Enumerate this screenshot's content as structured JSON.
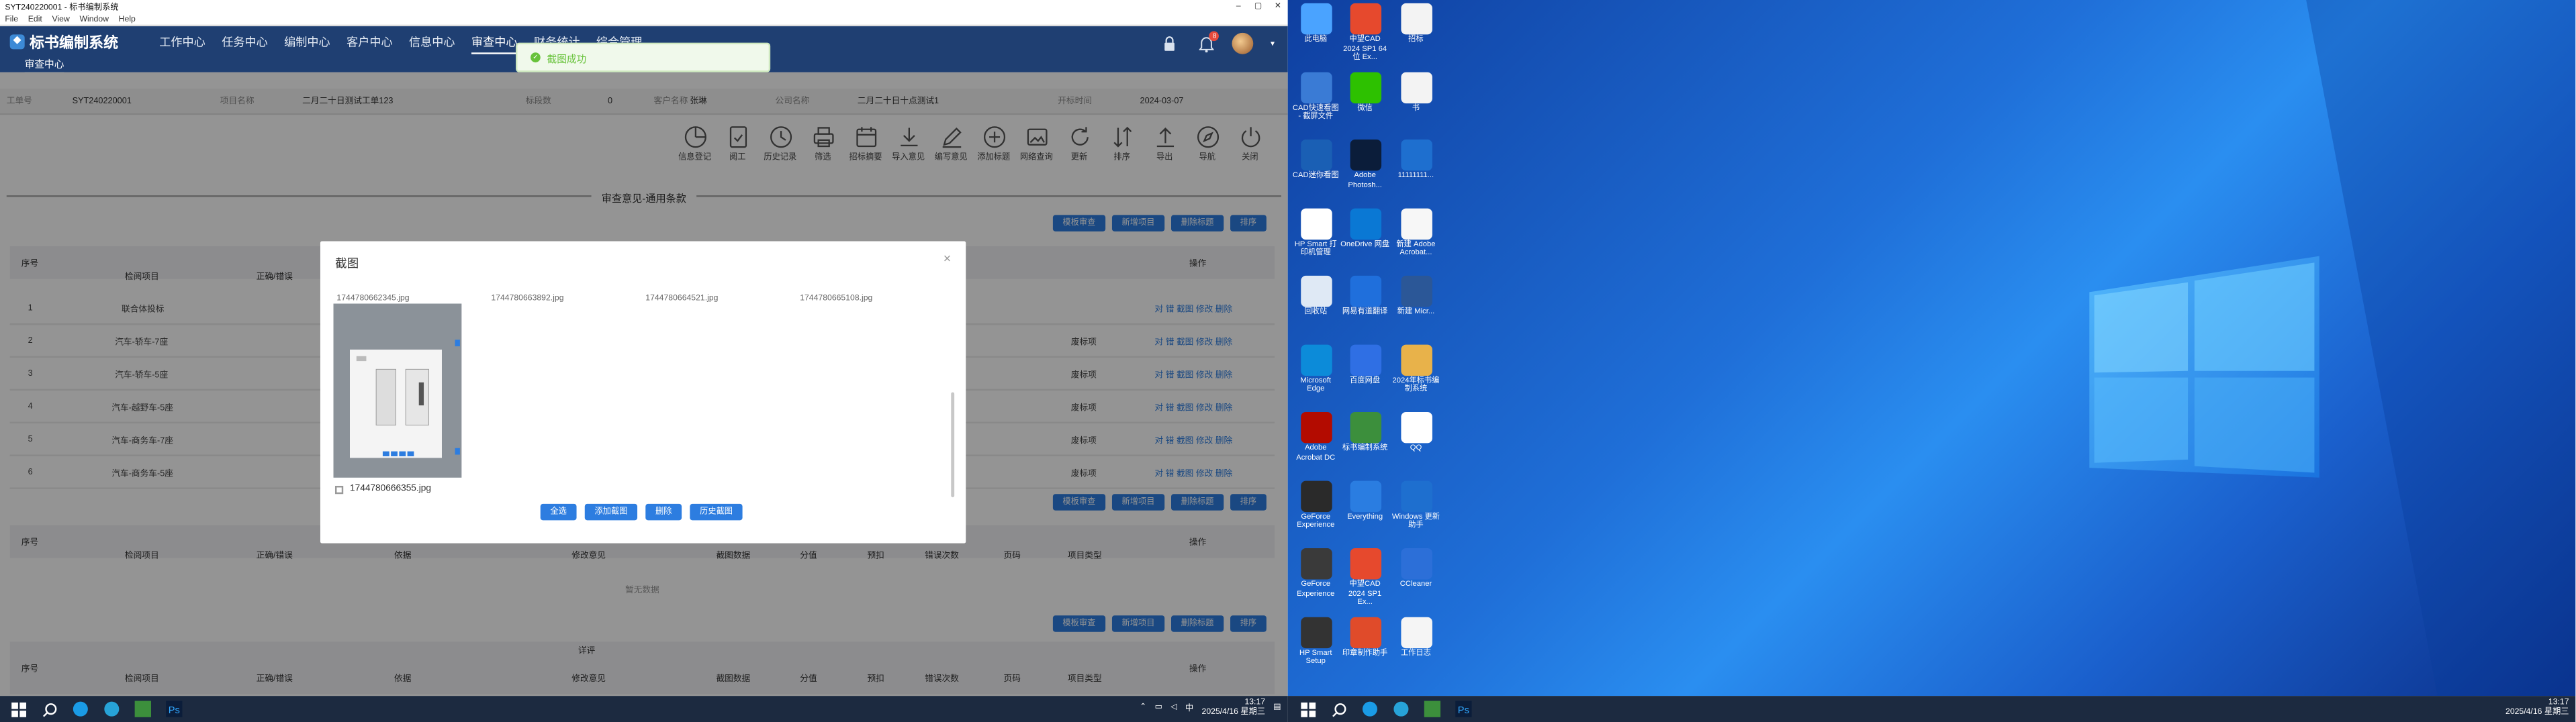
{
  "window": {
    "title": "SYT240220001 - 标书编制系统",
    "menu": [
      "File",
      "Edit",
      "View",
      "Window",
      "Help"
    ]
  },
  "appbar": {
    "logo": "标书编制系统",
    "nav": [
      "工作中心",
      "任务中心",
      "编制中心",
      "客户中心",
      "信息中心",
      "审查中心",
      "财务统计",
      "综合管理"
    ],
    "active_nav": "审查中心",
    "subnav": "审查中心",
    "badge_count": "8"
  },
  "toast": {
    "text": "截图成功"
  },
  "info": [
    {
      "label": "工单号",
      "value": "SYT240220001"
    },
    {
      "label": "项目名称",
      "value": "二月二十日测试工单123"
    },
    {
      "label": "标段数",
      "value": "0"
    },
    {
      "label": "客户名称",
      "value": "张琳"
    },
    {
      "label": "公司名称",
      "value": "二月二十日十点测试1"
    },
    {
      "label": "开标时间",
      "value": "2024-03-07"
    }
  ],
  "toolbar": [
    "信息登记",
    "阅工",
    "历史记录",
    "筛选",
    "招标摘要",
    "导入意见",
    "编写意见",
    "添加标题",
    "网络查询",
    "更新",
    "排序",
    "导出",
    "导航",
    "关闭"
  ],
  "section_title": "审查意见-通用条款",
  "action_buttons": [
    "模板审查",
    "新增项目",
    "删除标题",
    "排序"
  ],
  "table": {
    "headers": [
      "序号",
      "检阅项目",
      "正确/错误",
      "依据",
      "修改意见",
      "截图数据",
      "分值",
      "预扣",
      "错误次数",
      "页码",
      "项目类型",
      "操作"
    ],
    "rows": [
      {
        "no": "1",
        "item": "联合体投标",
        "type": "",
        "ops": "对  错  截图  修改  删除"
      },
      {
        "no": "2",
        "item": "汽车-轿车-7座",
        "type": "废标项",
        "ops": "对  错  截图  修改  删除"
      },
      {
        "no": "3",
        "item": "汽车-轿车-5座",
        "type": "废标项",
        "ops": "对  错  截图  修改  删除"
      },
      {
        "no": "4",
        "item": "汽车-越野车-5座",
        "type": "废标项",
        "ops": "对  错  截图  修改  删除"
      },
      {
        "no": "5",
        "item": "汽车-商务车-7座",
        "type": "废标项",
        "ops": "对  错  截图  修改  删除"
      },
      {
        "no": "6",
        "item": "汽车-商务车-5座",
        "type": "废标项",
        "ops": "对  错  截图  修改  删除"
      }
    ],
    "empty_text": "暂无数据",
    "section3_label": "详评"
  },
  "modal": {
    "title": "截图",
    "prev_names": [
      "1744780662345.jpg",
      "1744780663892.jpg",
      "1744780664521.jpg",
      "1744780665108.jpg"
    ],
    "file_name": "1744780666355.jpg",
    "buttons": [
      "全选",
      "添加截图",
      "删除",
      "历史截图"
    ]
  },
  "desktop_icons": [
    {
      "label": "此电脑",
      "color": "#4aa3ff"
    },
    {
      "label": "中望CAD 2024 SP1 64位 Ex...",
      "color": "#e6492d"
    },
    {
      "label": "招标",
      "color": "#f3f3f3"
    },
    {
      "label": "CAD快速看图 - 截屏文件",
      "color": "#3a7bd5"
    },
    {
      "label": "微信",
      "color": "#2dc100"
    },
    {
      "label": "书",
      "color": "#f3f3f3"
    },
    {
      "label": "CAD迷你看图",
      "color": "#1a5fb4"
    },
    {
      "label": "Adobe Photosh...",
      "color": "#0b1d3a"
    },
    {
      "label": "11111111...",
      "color": "#1e6fcf"
    },
    {
      "label": "HP Smart 打印机管理",
      "color": "#ffffff"
    },
    {
      "label": "OneDrive 网盘",
      "color": "#0a78d4"
    },
    {
      "label": "新建 Adobe Acrobat...",
      "color": "#f7f7f7"
    },
    {
      "label": "回收站",
      "color": "#dfe9f5"
    },
    {
      "label": "网易有道翻译",
      "color": "#1f6fdc"
    },
    {
      "label": "新建 Micr...",
      "color": "#2b5797"
    },
    {
      "label": "Microsoft Edge",
      "color": "#0c8bd9"
    },
    {
      "label": "百度网盘",
      "color": "#2f6fe4"
    },
    {
      "label": "2024年标书编制系统",
      "color": "#e8b24a"
    },
    {
      "label": "Adobe Acrobat DC",
      "color": "#b30b00"
    },
    {
      "label": "标书编制系统",
      "color": "#3c8f3c"
    },
    {
      "label": "QQ",
      "color": "#ffffff"
    },
    {
      "label": "GeForce Experience",
      "color": "#2a2a2a"
    },
    {
      "label": "Everything",
      "color": "#2a7de1"
    },
    {
      "label": "Windows 更新助手",
      "color": "#1e6fcf"
    },
    {
      "label": "GeForce Experience",
      "color": "#3a3a3a"
    },
    {
      "label": "中望CAD 2024 SP1 Ex...",
      "color": "#e6492d"
    },
    {
      "label": "CCleaner",
      "color": "#2c6fd8"
    },
    {
      "label": "HP Smart Setup",
      "color": "#333333"
    },
    {
      "label": "印章制作助手",
      "color": "#e04b2a"
    },
    {
      "label": "工作日志",
      "color": "#f5f5f5"
    }
  ],
  "taskbar": {
    "time": "13:17",
    "date": "2025/4/16 星期三"
  },
  "colors": {
    "appbar": "#1f3f72",
    "primary_button": "#2d7de0",
    "toast_green": "#67c23a",
    "taskbar": "#1c2a40"
  }
}
